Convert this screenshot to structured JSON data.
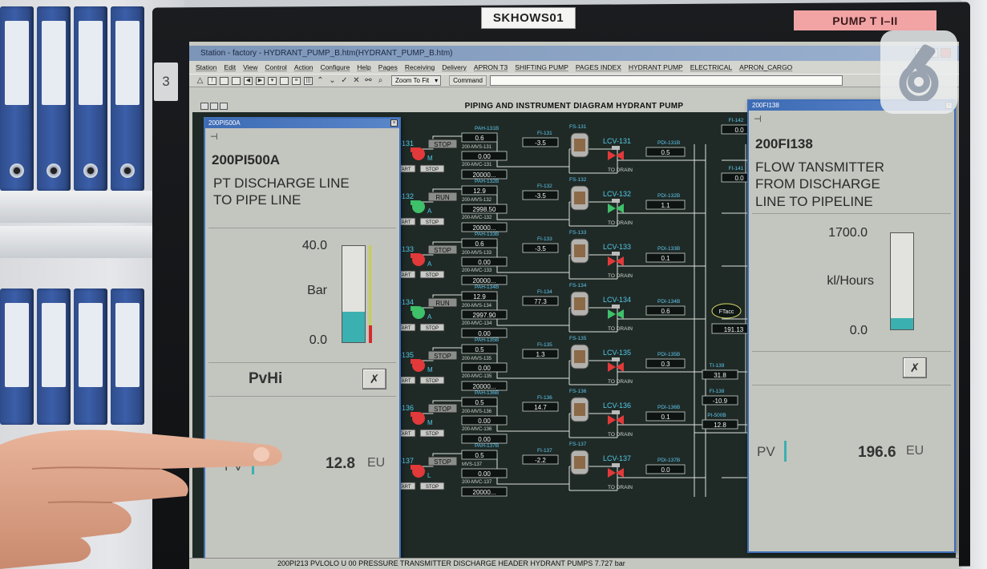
{
  "stickers": {
    "host": "SKHOWS01",
    "pump": "PUMP T I–II",
    "bezel_number": "3"
  },
  "window": {
    "title": "Station - factory - HYDRANT_PUMP_B.htm(HYDRANT_PUMP_B.htm)"
  },
  "menu": [
    "Station",
    "Edit",
    "View",
    "Control",
    "Action",
    "Configure",
    "Help",
    "Pages",
    "Receiving",
    "Delivery",
    "APRON T3",
    "SHIFTING PUMP",
    "PAGES INDEX",
    "HYDRANT PUMP",
    "ELECTRICAL",
    "APRON_CARGO"
  ],
  "toolbar": {
    "zoom": "Zoom To Fit",
    "command_label": "Command"
  },
  "diagram": {
    "title": "PIPING AND INSTRUMENT DIAGRAM HYDRANT PUMP",
    "pumps": [
      {
        "name": "P-131",
        "state": "STOP",
        "mode": "M",
        "pah_tag": "PAH-131B",
        "pah": "0.6",
        "mvs_tag": "200-MVS-131",
        "mvs": "0.00",
        "mvc_tag": "200-MVC-131",
        "mvc": "20000...",
        "fi_tag": "FI-131",
        "fi": "-3.5",
        "fs_tag": "FS-131",
        "lcv": "LCV-131",
        "pdi_tag": "PDI-131B",
        "pdi": "0.5",
        "running": false
      },
      {
        "name": "P-132",
        "state": "RUN",
        "mode": "A",
        "pah_tag": "PAH-132B",
        "pah": "12.9",
        "mvs_tag": "200-MVS-132",
        "mvs": "2998.50",
        "mvc_tag": "200-MVC-132",
        "mvc": "20000...",
        "fi_tag": "FI-132",
        "fi": "-3.5",
        "fs_tag": "FS-132",
        "lcv": "LCV-132",
        "pdi_tag": "PDI-132B",
        "pdi": "1.1",
        "running": true
      },
      {
        "name": "P-133",
        "state": "STOP",
        "mode": "A",
        "pah_tag": "PAH-133B",
        "pah": "0.6",
        "mvs_tag": "200-MVS-133",
        "mvs": "0.00",
        "mvc_tag": "200-MVC-133",
        "mvc": "20000...",
        "fi_tag": "FI-133",
        "fi": "-3.5",
        "fs_tag": "FS-133",
        "lcv": "LCV-133",
        "pdi_tag": "PDI-133B",
        "pdi": "0.1",
        "running": false
      },
      {
        "name": "P-134",
        "state": "RUN",
        "mode": "A",
        "pah_tag": "PAH-134B",
        "pah": "12.9",
        "mvs_tag": "200-MVS-134",
        "mvs": "2997.90",
        "mvc_tag": "200-MVC-134",
        "mvc": "0.00",
        "fi_tag": "FI-134",
        "fi": "77.3",
        "fs_tag": "FS-134",
        "lcv": "LCV-134",
        "pdi_tag": "PDI-134B",
        "pdi": "0.6",
        "running": true
      },
      {
        "name": "P-135",
        "state": "STOP",
        "mode": "M",
        "pah_tag": "PAH-135B",
        "pah": "0.5",
        "mvs_tag": "200-MVS-135",
        "mvs": "0.00",
        "mvc_tag": "200-MVC-135",
        "mvc": "20000...",
        "fi_tag": "FI-135",
        "fi": "1.3",
        "fs_tag": "FS-135",
        "lcv": "LCV-135",
        "pdi_tag": "PDI-135B",
        "pdi": "0.3",
        "running": false
      },
      {
        "name": "P-136",
        "state": "STOP",
        "mode": "M",
        "pah_tag": "PAH-136B",
        "pah": "0.5",
        "mvs_tag": "200-MVS-136",
        "mvs": "0.00",
        "mvc_tag": "200-MVC-136",
        "mvc": "0.00",
        "fi_tag": "FI-136",
        "fi": "14.7",
        "fs_tag": "FS-136",
        "lcv": "LCV-136",
        "pdi_tag": "PDI-136B",
        "pdi": "0.1",
        "running": false
      },
      {
        "name": "P-137",
        "state": "STOP",
        "mode": "L",
        "pah_tag": "PAH-137B",
        "pah": "0.5",
        "mvs_tag": "MVS-137",
        "mvs": "0.00",
        "mvc_tag": "200-MVC-137",
        "mvc": "20000...",
        "fi_tag": "FI-137",
        "fi": "-2.2",
        "fs_tag": "FS-137",
        "lcv": "LCV-137",
        "pdi_tag": "PDI-137B",
        "pdi": "0.0",
        "running": false
      }
    ],
    "start_label": "START",
    "stop_label": "STOP",
    "drain_label": "TO DRAIN",
    "right_instruments": [
      {
        "tag": "FI-142",
        "value": "0.0"
      },
      {
        "tag": "FI-141",
        "value": "0.0"
      },
      {
        "tag": "FTacc",
        "value": "191.13"
      },
      {
        "tag": "TI-139",
        "value": "31.8"
      },
      {
        "tag": "FI-138",
        "value": "-10.9"
      },
      {
        "tag": "PI-500B",
        "value": "12.8"
      }
    ]
  },
  "faceplate_left": {
    "window_title": "200PI500A",
    "tag": "200PI500A",
    "description": [
      "PT DISCHARGE LINE",
      "TO PIPE LINE"
    ],
    "range_high": "40.0",
    "range_low": "0.0",
    "unit": "Bar",
    "level_fraction": 0.32,
    "status": "PvHi",
    "pv_label": "PV",
    "pv_value": "12.8",
    "pv_unit": "EU"
  },
  "faceplate_right": {
    "window_title": "200FI138",
    "tag": "200FI138",
    "description": [
      "FLOW TANSMITTER",
      "FROM DISCHARGE",
      "LINE TO PIPELINE"
    ],
    "range_high": "1700.0",
    "range_low": "0.0",
    "unit": "kl/Hours",
    "level_fraction": 0.115,
    "pv_label": "PV",
    "pv_value": "196.6",
    "pv_unit": "EU"
  },
  "status_bar": "200PI213   PVLOLO   U 00 PRESSURE TRANSMITTER DISCHARGE HEADER HYDRANT PUMPS   7.727   bar",
  "colors": {
    "running_pump": "#3fc06a",
    "stopped_pump": "#e2393a",
    "bar_fill": "#3bb0b0",
    "diagram_bg": "#1f2a26",
    "faceplate_border": "#3f6fb8"
  }
}
